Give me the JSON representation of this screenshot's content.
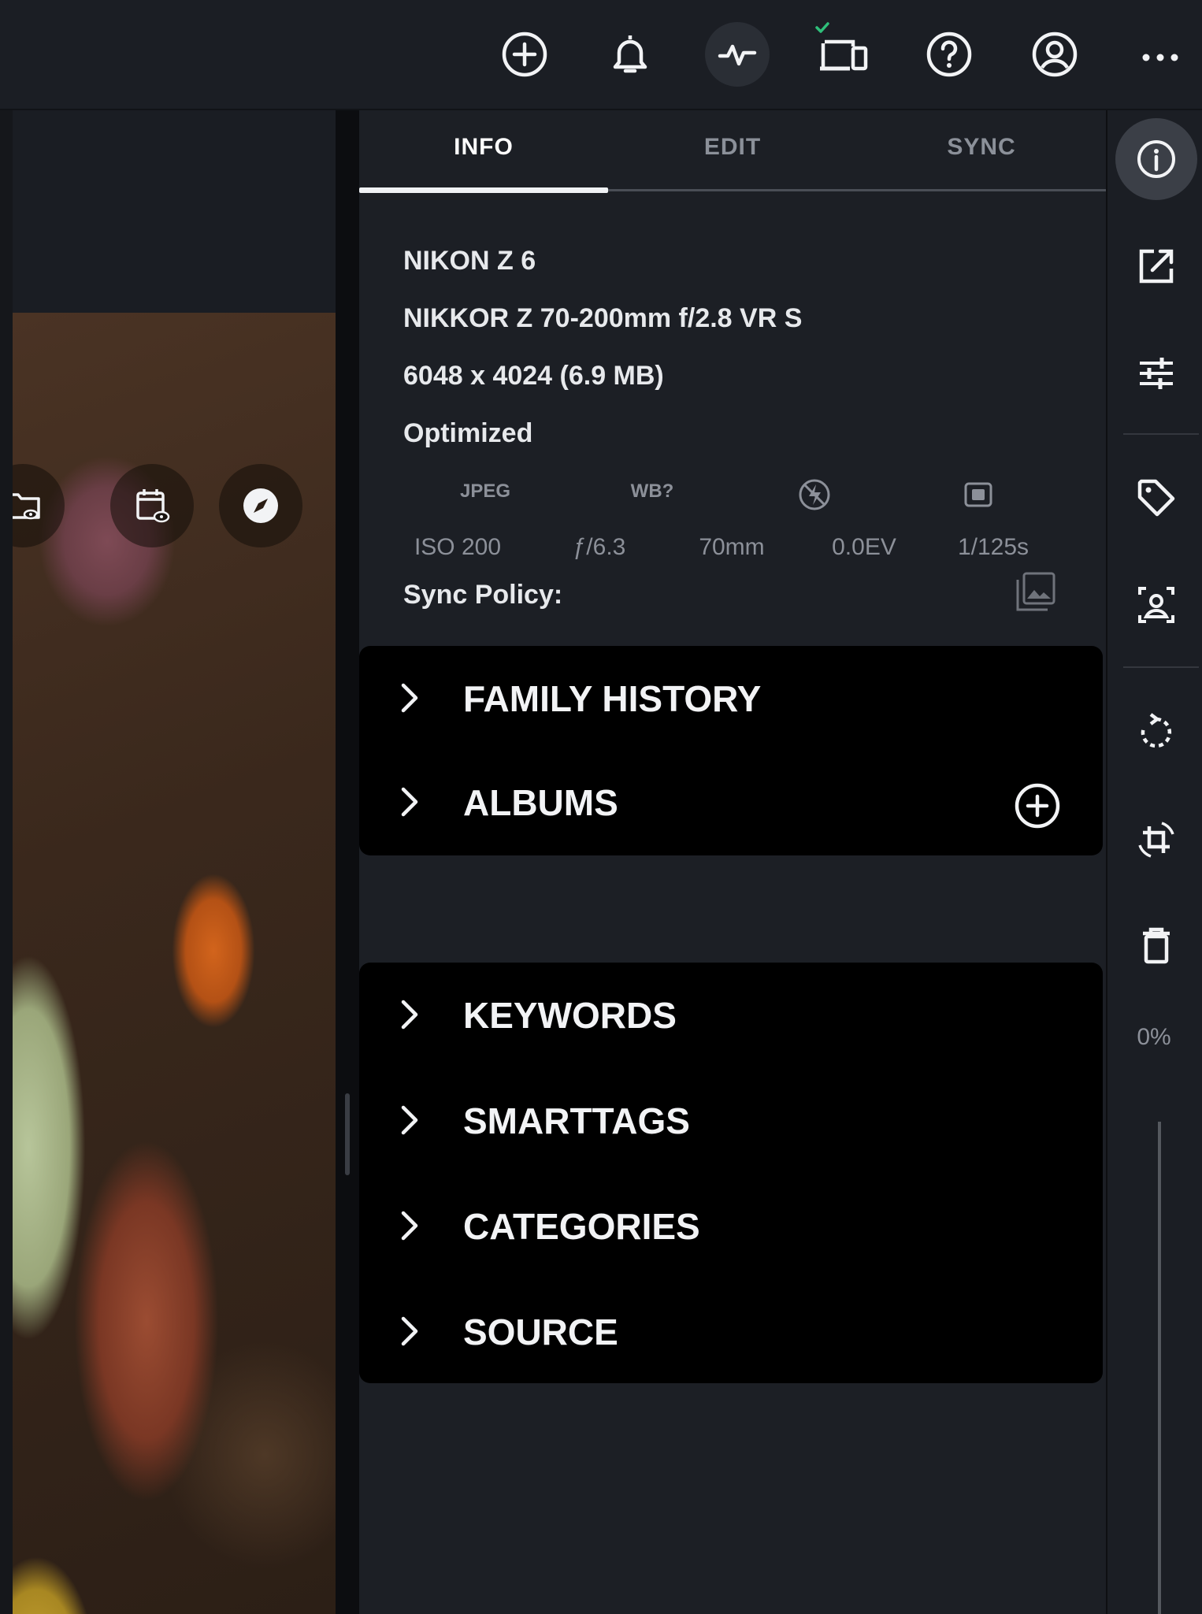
{
  "colors": {
    "background": "#1a1d23",
    "panel": "#1c1f25",
    "section": "#000000",
    "accent_check": "#2fbf7a",
    "text": "#e6e8eb",
    "muted": "#8c9099"
  },
  "topbar": {
    "icons": [
      "add-circle-icon",
      "bell-icon",
      "activity-icon",
      "devices-icon",
      "help-icon",
      "account-icon",
      "more-icon"
    ],
    "synced_check": true
  },
  "viewer": {
    "overlay_icons": [
      "folder-eye-icon",
      "calendar-eye-icon",
      "compass-icon"
    ]
  },
  "panel": {
    "tabs": [
      {
        "label": "INFO",
        "active": true
      },
      {
        "label": "EDIT",
        "active": false
      },
      {
        "label": "SYNC",
        "active": false
      }
    ],
    "camera": "NIKON Z 6",
    "lens": "NIKKOR Z 70-200mm f/2.8 VR S",
    "dimensions": "6048 x 4024 (6.9 MB)",
    "status": "Optimized",
    "badges": {
      "format": "JPEG",
      "white_balance": "WB?",
      "flash_icon": "flash-off-icon",
      "metering_icon": "metering-icon"
    },
    "exposure": {
      "iso": "ISO 200",
      "aperture": "ƒ/6.3",
      "focal_length": "70mm",
      "ev": "0.0EV",
      "shutter": "1/125s"
    },
    "sync_policy_label": "Sync Policy:",
    "sync_policy_icon": "gallery-stack-icon",
    "section_one": [
      "FAMILY HISTORY",
      "ALBUMS"
    ],
    "section_two": [
      "KEYWORDS",
      "SMARTTAGS",
      "CATEGORIES",
      "SOURCE"
    ]
  },
  "rail": {
    "icons": [
      "info-icon",
      "open-external-icon",
      "adjustments-icon",
      "tag-icon",
      "face-scan-icon",
      "rotate-icon",
      "crop-rotate-icon",
      "trash-icon"
    ],
    "zoom_label": "0%",
    "zoom_value": 0
  }
}
